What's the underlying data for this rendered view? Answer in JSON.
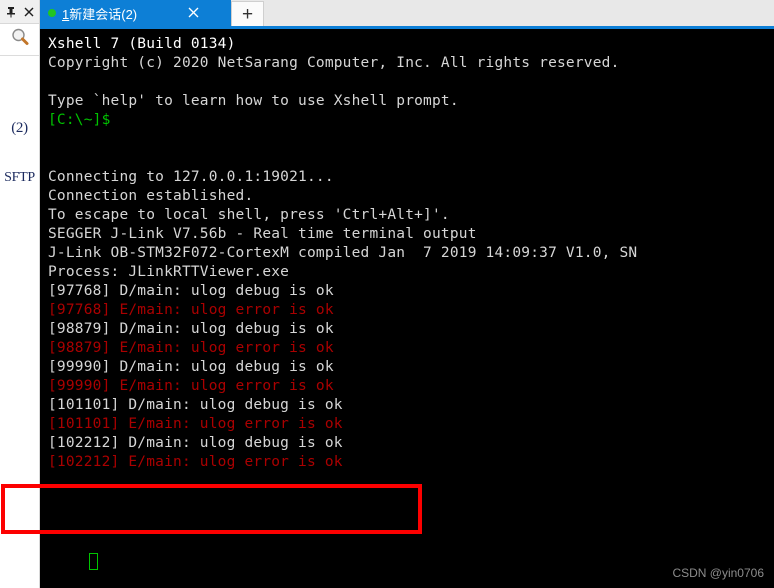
{
  "window": {
    "left_panel": {
      "pin_icon": "pin-icon",
      "close_icon": "close-icon",
      "search_icon": "search-icon",
      "tabs": [
        {
          "label": "(2)",
          "name": "sessions"
        },
        {
          "label": "SFTP",
          "name": "sftp"
        }
      ]
    },
    "tabbar": {
      "accent_color": "#0d7fd6",
      "active_tab": {
        "number": "1",
        "title": "新建会话",
        "count": "(2)",
        "status_dot_color": "#22c522",
        "close_icon": "close-icon"
      },
      "new_tab_label": "+"
    }
  },
  "terminal": {
    "background": "#000000",
    "cursor_color": "#00c400",
    "lines": [
      {
        "text": "Xshell 7 (Build 0134)",
        "color": "bright"
      },
      {
        "text": "Copyright (c) 2020 NetSarang Computer, Inc. All rights reserved.",
        "color": "white"
      },
      {
        "text": "",
        "color": "white"
      },
      {
        "text": "Type `help' to learn how to use Xshell prompt.",
        "color": "white"
      },
      {
        "text": "[C:\\~]$",
        "color": "green"
      },
      {
        "text": "",
        "color": "white"
      },
      {
        "text": "",
        "color": "white"
      },
      {
        "text": "Connecting to 127.0.0.1:19021...",
        "color": "white"
      },
      {
        "text": "Connection established.",
        "color": "white"
      },
      {
        "text": "To escape to local shell, press 'Ctrl+Alt+]'.",
        "color": "white"
      },
      {
        "text": "SEGGER J-Link V7.56b - Real time terminal output",
        "color": "white"
      },
      {
        "text": "J-Link OB-STM32F072-CortexM compiled Jan  7 2019 14:09:37 V1.0, SN",
        "color": "white"
      },
      {
        "text": "Process: JLinkRTTViewer.exe",
        "color": "white"
      },
      {
        "text": "[97768] D/main: ulog debug is ok",
        "color": "white"
      },
      {
        "text": "[97768] E/main: ulog error is ok",
        "color": "red"
      },
      {
        "text": "[98879] D/main: ulog debug is ok",
        "color": "white"
      },
      {
        "text": "[98879] E/main: ulog error is ok",
        "color": "red"
      },
      {
        "text": "[99990] D/main: ulog debug is ok",
        "color": "white"
      },
      {
        "text": "[99990] E/main: ulog error is ok",
        "color": "red"
      },
      {
        "text": "[101101] D/main: ulog debug is ok",
        "color": "white"
      },
      {
        "text": "[101101] E/main: ulog error is ok",
        "color": "red"
      },
      {
        "text": "[102212] D/main: ulog debug is ok",
        "color": "white"
      },
      {
        "text": "[102212] E/main: ulog error is ok",
        "color": "red"
      }
    ]
  },
  "annotation": {
    "box_color": "#fd0000"
  },
  "watermark": {
    "text": "CSDN @yin0706"
  }
}
